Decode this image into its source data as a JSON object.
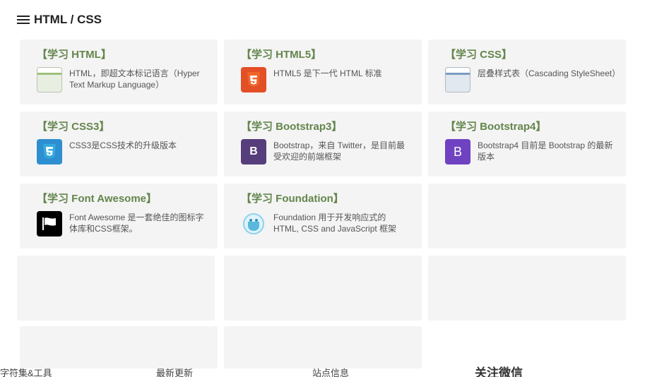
{
  "section": {
    "title": "HTML / CSS",
    "icon": "list-icon"
  },
  "cards": [
    {
      "title": "【学习 HTML】",
      "desc": "HTML，即超文本标记语言（Hyper Text Markup Language）",
      "icon": "html-logo-icon"
    },
    {
      "title": "【学习 HTML5】",
      "desc": "HTML5 是下一代 HTML 标准",
      "icon": "html5-logo-icon",
      "color": "#e34f26"
    },
    {
      "title": "【学习 CSS】",
      "desc": "层叠样式表（Cascading StyleSheet）",
      "icon": "css-logo-icon"
    },
    {
      "title": "【学习 CSS3】",
      "desc": "CSS3是CSS技术的升级版本",
      "icon": "css3-logo-icon",
      "color": "#2d8fd1"
    },
    {
      "title": "【学习 Bootstrap3】",
      "desc": "Bootstrap，来自 Twitter，是目前最受欢迎的前端框架",
      "icon": "bootstrap3-logo-icon",
      "color": "#563d7c",
      "letter": "B"
    },
    {
      "title": "【学习 Bootstrap4】",
      "desc": "Bootstrap4 目前是 Bootstrap 的最新版本",
      "icon": "bootstrap4-logo-icon",
      "color": "#6f42c1",
      "letter": "B"
    },
    {
      "title": "【学习 Font Awesome】",
      "desc": "Font Awesome 是一套绝佳的图标字体库和CSS框架。",
      "icon": "font-awesome-flag-icon",
      "color": "#000000"
    },
    {
      "title": "【学习 Foundation】",
      "desc": "Foundation 用于开发响应式的 HTML, CSS and JavaScript 框架",
      "icon": "foundation-logo-icon"
    }
  ],
  "footer": {
    "charset_tools": "字符集&工具",
    "latest_updates": "最新更新",
    "site_info": "站点信息",
    "follow_wechat": "关注微信"
  }
}
